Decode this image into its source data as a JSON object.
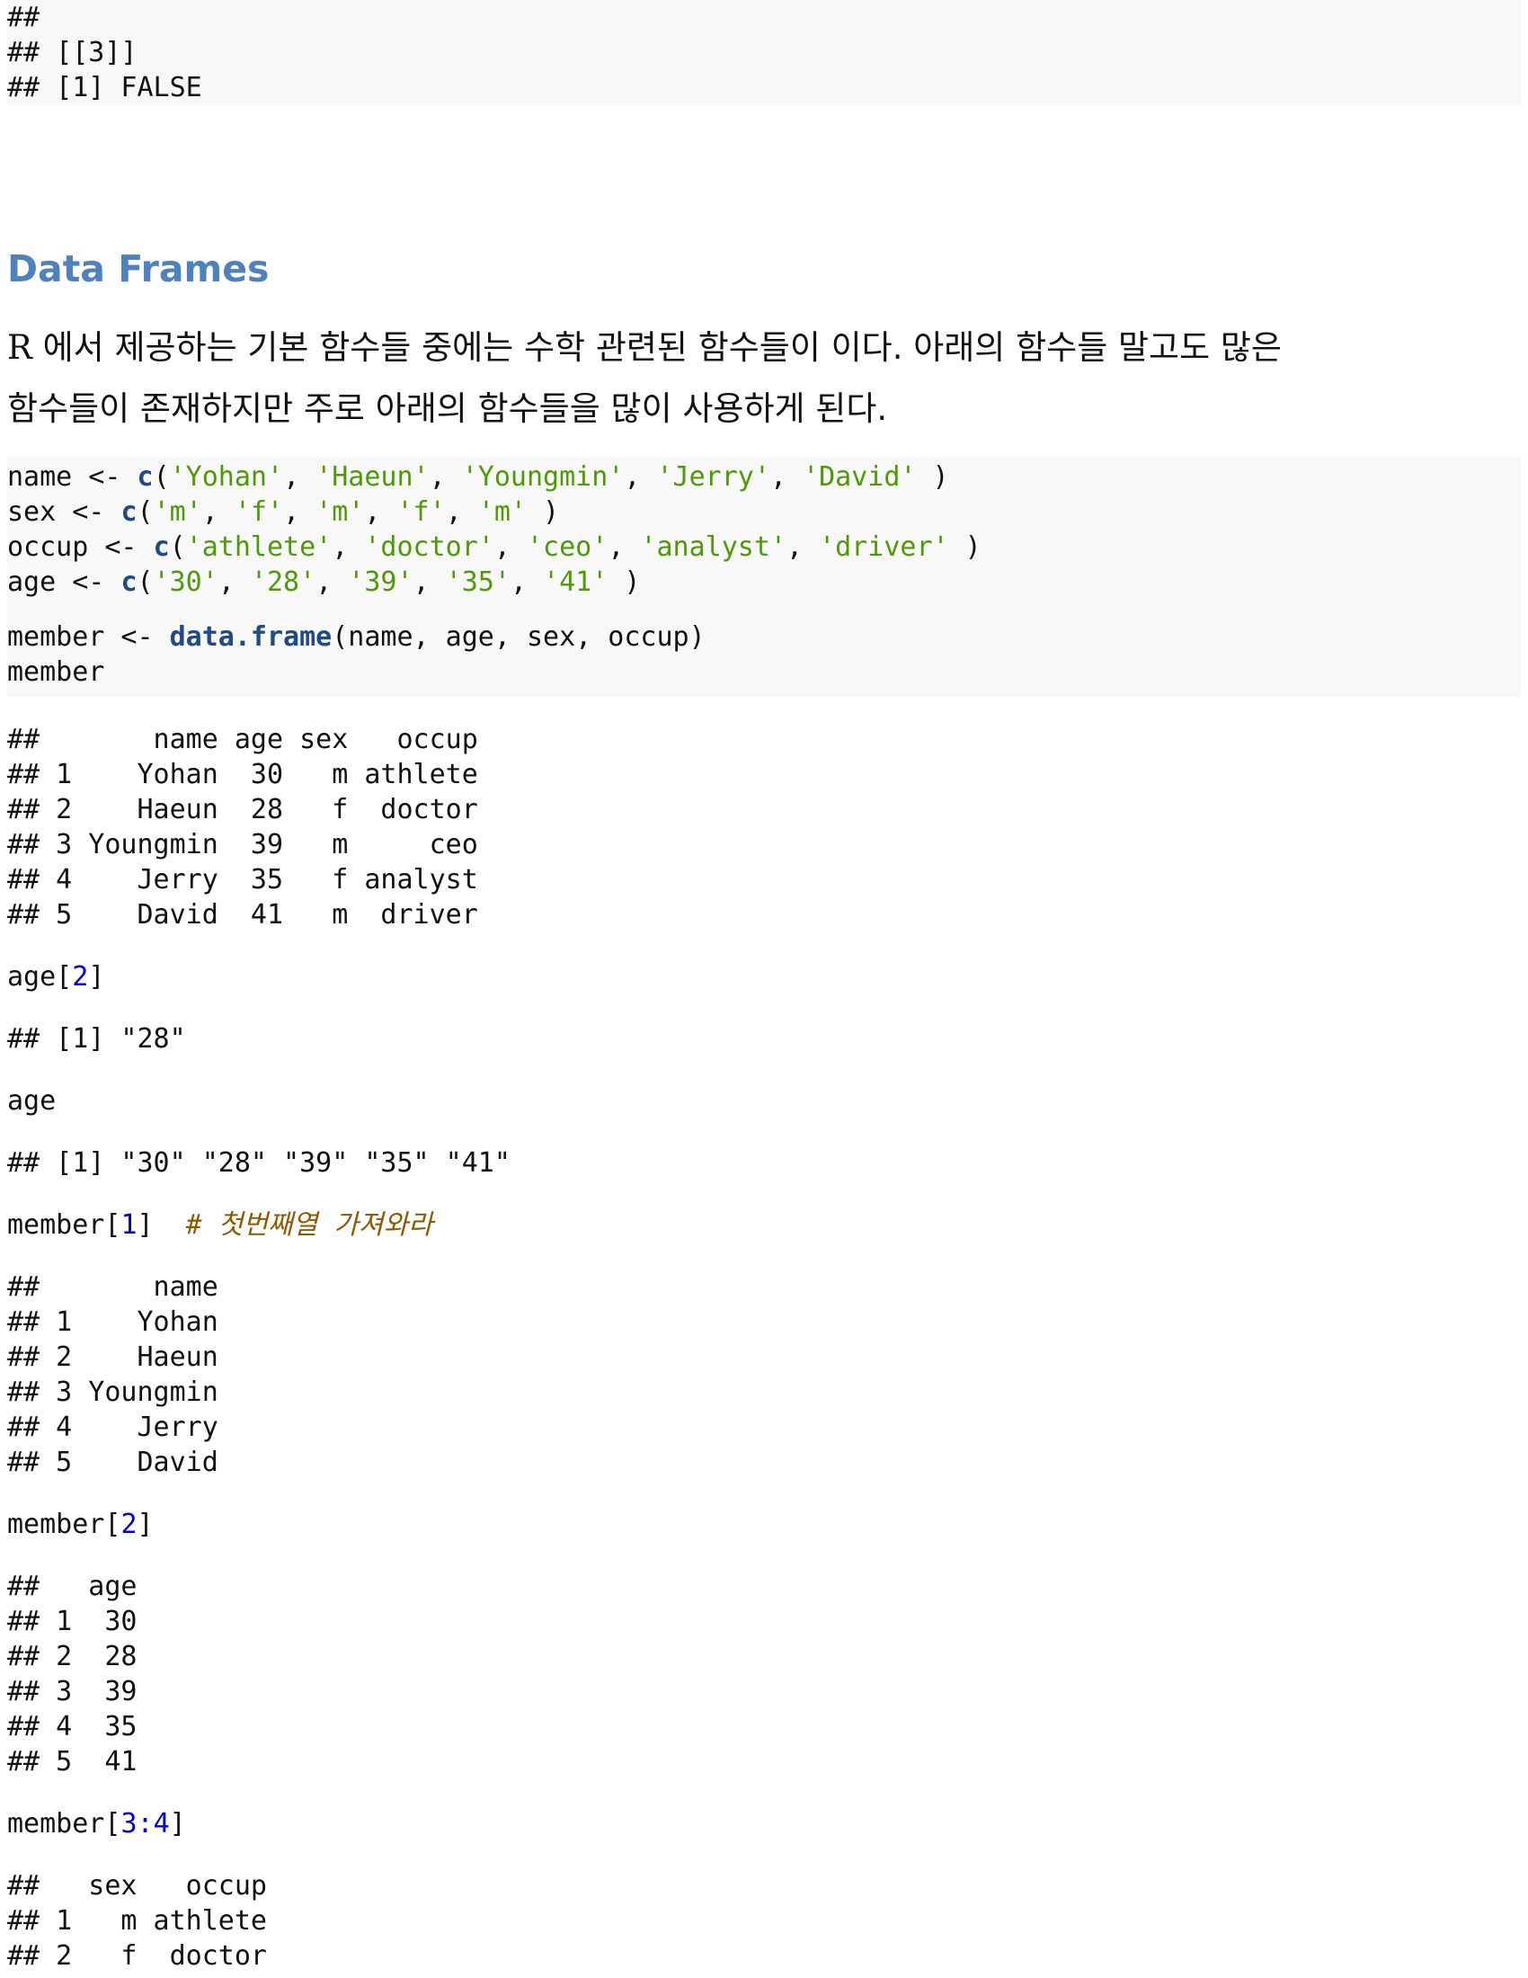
{
  "top_output": [
    "##",
    "## [[3]]",
    "## [1] FALSE"
  ],
  "section_title": "Data Frames",
  "intro": {
    "lead": "R",
    "text_line1": " 에서 제공하는 기본 함수들 중에는 수학 관련된 함수들이 이다. 아래의 함수들 말고도 많은",
    "text_line2": "함수들이 존재하지만 주로 아래의 함수들을 많이 사용하게 된다."
  },
  "code1": {
    "name_var": "name <- ",
    "c_fn": "c",
    "name_args": [
      "'Yohan'",
      "'Haeun'",
      "'Youngmin'",
      "'Jerry'",
      "'David'"
    ],
    "sex_var": "sex <- ",
    "sex_args": [
      "'m'",
      "'f'",
      "'m'",
      "'f'",
      "'m'"
    ],
    "occup_var": "occup <- ",
    "occup_args": [
      "'athlete'",
      "'doctor'",
      "'ceo'",
      "'analyst'",
      "'driver'"
    ],
    "age_var": "age <- ",
    "age_args": [
      "'30'",
      "'28'",
      "'39'",
      "'35'",
      "'41'"
    ],
    "member_assign": "member <- ",
    "df_fn": "data.frame",
    "df_args": "(name, age, sex, occup)",
    "member_print": "member"
  },
  "out_member": [
    "##       name age sex   occup",
    "## 1    Yohan  30   m athlete",
    "## 2    Haeun  28   f  doctor",
    "## 3 Youngmin  39   m     ceo",
    "## 4    Jerry  35   f analyst",
    "## 5    David  41   m  driver"
  ],
  "code_age2": {
    "pre": "age[",
    "idx": "2",
    "post": "]"
  },
  "out_age2": "## [1] \"28\"",
  "code_age": "age",
  "out_age": "## [1] \"30\" \"28\" \"39\" \"35\" \"41\"",
  "code_m1": {
    "pre": "member[",
    "idx": "1",
    "post": "]",
    "comment": "  # 첫번째열 가져와라"
  },
  "out_m1": [
    "##       name",
    "## 1    Yohan",
    "## 2    Haeun",
    "## 3 Youngmin",
    "## 4    Jerry",
    "## 5    David"
  ],
  "code_m2": {
    "pre": "member[",
    "idx": "2",
    "post": "]"
  },
  "out_m2": [
    "##   age",
    "## 1  30",
    "## 2  28",
    "## 3  39",
    "## 4  35",
    "## 5  41"
  ],
  "code_m34": {
    "pre": "member[",
    "idx_a": "3",
    "colon": ":",
    "idx_b": "4",
    "post": "]"
  },
  "out_m34": [
    "##   sex   occup",
    "## 1   m athlete",
    "## 2   f  doctor"
  ]
}
